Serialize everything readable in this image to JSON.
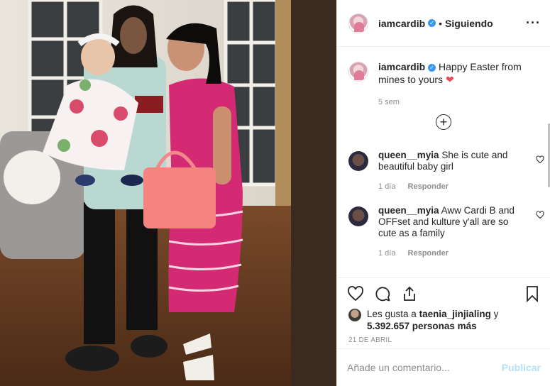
{
  "post": {
    "username": "iamcardib",
    "follow_separator": "•",
    "follow_status": "Siguiendo",
    "more_icon": "ellipsis-icon"
  },
  "caption": {
    "username": "iamcardib",
    "text": "Happy Easter from mines to yours",
    "emoji": "❤",
    "time": "5 sem"
  },
  "load_more_icon": "plus-circle-icon",
  "comments": [
    {
      "username": "queen__myia",
      "text": "She is cute and beautiful baby girl",
      "time": "1 día",
      "reply_label": "Responder"
    },
    {
      "username": "queen__myia",
      "text": "Aww Cardi B and OFFset and kulture y'all are so cute as a family",
      "time": "1 día",
      "reply_label": "Responder"
    }
  ],
  "actions": {
    "icons": [
      "heart-icon",
      "comment-icon",
      "share-icon",
      "bookmark-icon"
    ]
  },
  "likes": {
    "prefix": "Les gusta a",
    "user": "taenia_jinjialing",
    "joiner": "y",
    "count": "5.392.657 personas más"
  },
  "date": "21 DE ABRIL",
  "add_comment": {
    "placeholder": "Añade un comentario...",
    "publish_label": "Publicar"
  },
  "colors": {
    "link_blue": "#3897f0",
    "publish_disabled": "#b2dffc",
    "secondary_text": "#8e8e8e",
    "heart_red": "#ed4956",
    "dress_pink": "#e0357b"
  }
}
